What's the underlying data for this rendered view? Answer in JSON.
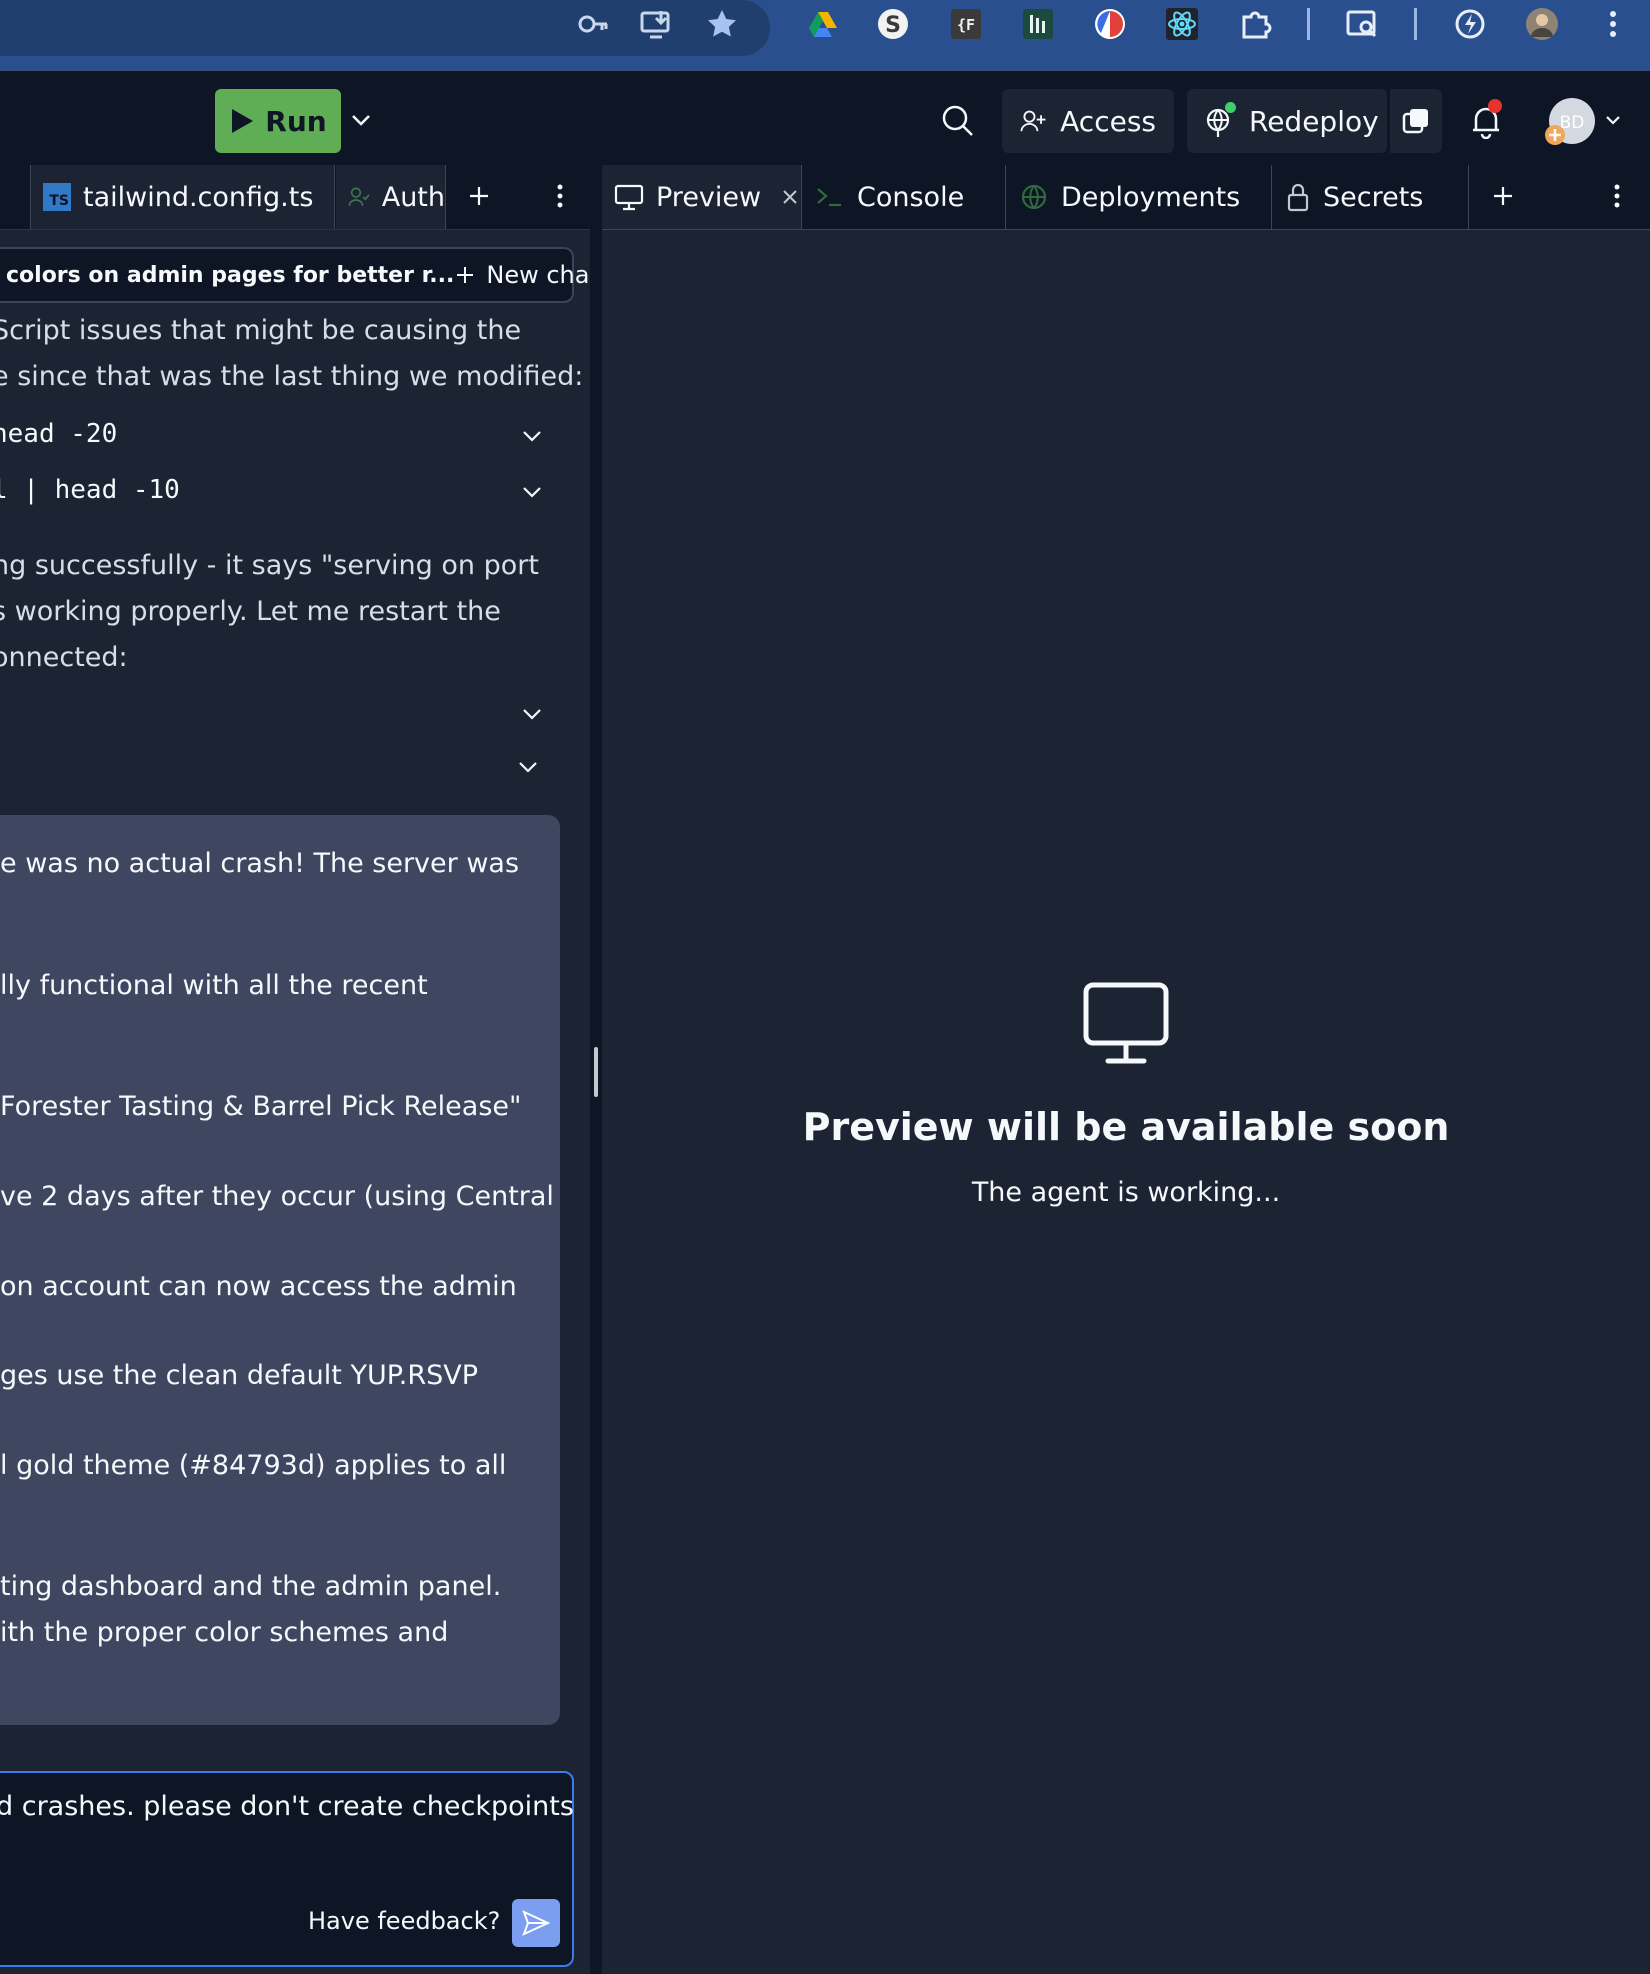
{
  "topbar": {
    "run_label": "Run",
    "access_label": "Access",
    "redeploy_label": "Redeploy",
    "avatar_initials": "BD"
  },
  "left_tabs": {
    "file_tab": "tailwind.config.ts",
    "file_badge": "TS",
    "auth_tab": "Auth"
  },
  "chat": {
    "title": "colors on admin pages for better r...",
    "new_chat_label": "New chat",
    "intro_lines": [
      "Script issues that might be causing the",
      "e since that was the last thing we modified:"
    ],
    "code_lines": [
      " head -20",
      "l | head -10"
    ],
    "status_lines": [
      "ng successfully - it says \"serving on port",
      "s working properly. Let me restart the",
      "onnected:"
    ],
    "summary_lines": [
      "e was no actual crash! The server was",
      "lly functional with all the recent",
      " Forester Tasting & Barrel Pick Release\"",
      "ve 2 days after they occur (using Central",
      "on account can now access the admin",
      "ges use the clean default YUP.RSVP",
      "l gold theme (#84793d) applies to all",
      "ting dashboard and the admin panel.",
      "ith the proper color schemes and"
    ],
    "input_text": "d crashes. please don't create checkpoints",
    "feedback_label": "Have feedback?"
  },
  "right_tabs": {
    "preview": "Preview",
    "console": "Console",
    "deployments": "Deployments",
    "secrets": "Secrets"
  },
  "preview": {
    "title": "Preview will be available soon",
    "subtitle": "The agent is working..."
  },
  "colors": {
    "run_green": "#5fae56",
    "background": "#0e1525",
    "panel": "#1c2333",
    "card": "#3e4660",
    "input_border": "#3b7ce8"
  }
}
